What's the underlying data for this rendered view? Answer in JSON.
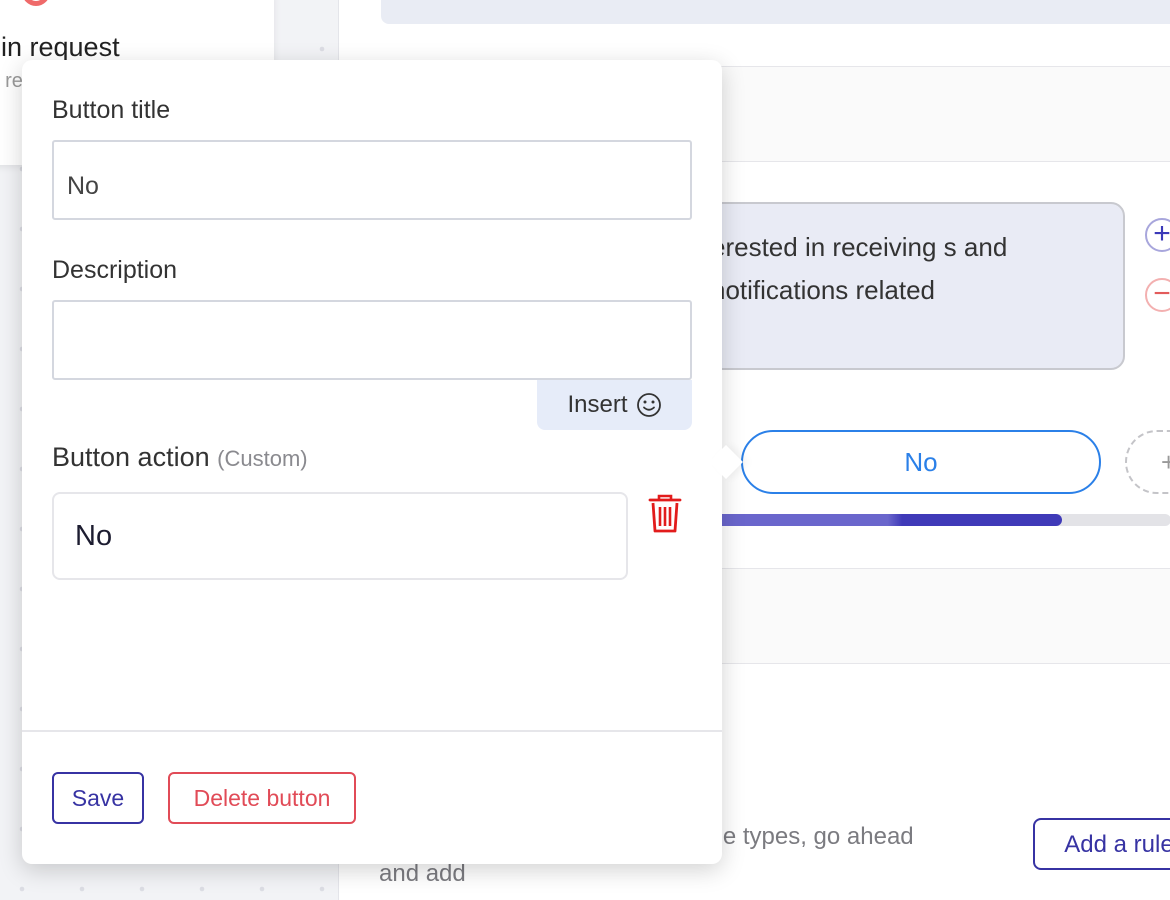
{
  "background": {
    "card_title": "-in request",
    "card_subtitle": "t re"
  },
  "main": {
    "message_text": "erested in receiving s and notifications related",
    "add_response_symbol": "+",
    "remove_response_symbol": "−",
    "no_pill_label": "No",
    "dashed_pill_symbol": "+",
    "progress_fraction": 0.77,
    "description_text": "f depending on different response types, go ahead and add",
    "add_rule_label": "Add a rule"
  },
  "popup": {
    "button_title_label": "Button title",
    "button_title_value": "No",
    "description_label": "Description",
    "description_value": "",
    "insert_label": "Insert",
    "insert_icon": "smiley-icon",
    "button_action_label": "Button action",
    "button_action_hint": "(Custom)",
    "button_action_value": "No",
    "trash_icon": "trash-icon",
    "save_label": "Save",
    "delete_label": "Delete button"
  },
  "colors": {
    "accent": "#3733a3",
    "pill_blue": "#2b80e8",
    "danger": "#e14b57"
  }
}
